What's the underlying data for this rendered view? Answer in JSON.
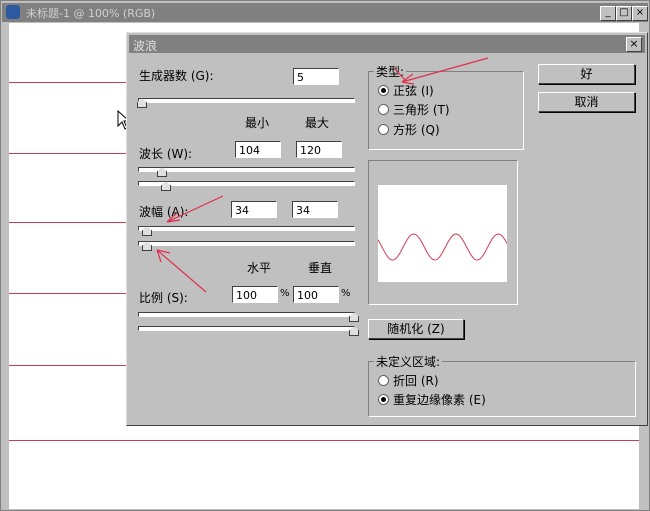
{
  "document": {
    "title": "未标题-1 @ 100% (RGB)",
    "minimize": "_",
    "maximize": "□",
    "close": "×"
  },
  "dialog": {
    "title": "波浪",
    "close": "×",
    "generators": {
      "label": "生成器数 (G):",
      "value": "5"
    },
    "col_min": "最小",
    "col_max": "最大",
    "wavelength": {
      "label": "波长 (W):",
      "min": "104",
      "max": "120"
    },
    "amplitude": {
      "label": "波幅 (A):",
      "min": "34",
      "max": "34"
    },
    "col_h": "水平",
    "col_v": "垂直",
    "scale": {
      "label": "比例 (S):",
      "h": "100",
      "v": "100",
      "unit": "%"
    },
    "type": {
      "legend": "类型:",
      "options": [
        {
          "label": "正弦 (I)",
          "selected": true
        },
        {
          "label": "三角形 (T)",
          "selected": false
        },
        {
          "label": "方形 (Q)",
          "selected": false
        }
      ]
    },
    "ok": "好",
    "cancel": "取消",
    "randomize": "随机化 (Z)",
    "undefined": {
      "legend": "未定义区域:",
      "options": [
        {
          "label": "折回 (R)",
          "selected": false
        },
        {
          "label": "重复边缘像素 (E)",
          "selected": true
        }
      ]
    },
    "colors": {
      "wave": "#d23c55",
      "annotation": "#e0304a",
      "guide": "#c83c50"
    }
  }
}
